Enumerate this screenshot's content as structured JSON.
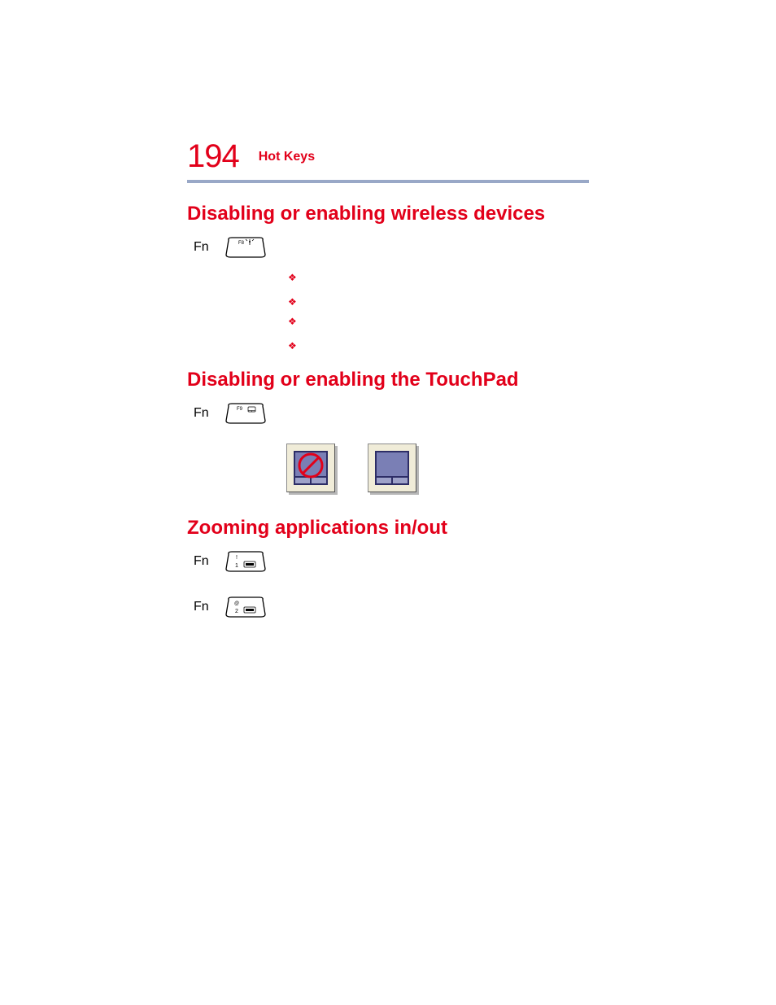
{
  "header": {
    "page_number": "194",
    "title": "Hot Keys"
  },
  "sections": {
    "wireless": {
      "heading": "Disabling or enabling wireless devices",
      "fn_label": "Fn",
      "key_label": "F8"
    },
    "touchpad": {
      "heading": "Disabling or enabling the TouchPad",
      "fn_label": "Fn",
      "key_label": "F9"
    },
    "zoom": {
      "heading": "Zooming applications in/out",
      "fn_label_1": "Fn",
      "key_label_1": "1",
      "fn_label_2": "Fn",
      "key_label_2": "2"
    }
  }
}
